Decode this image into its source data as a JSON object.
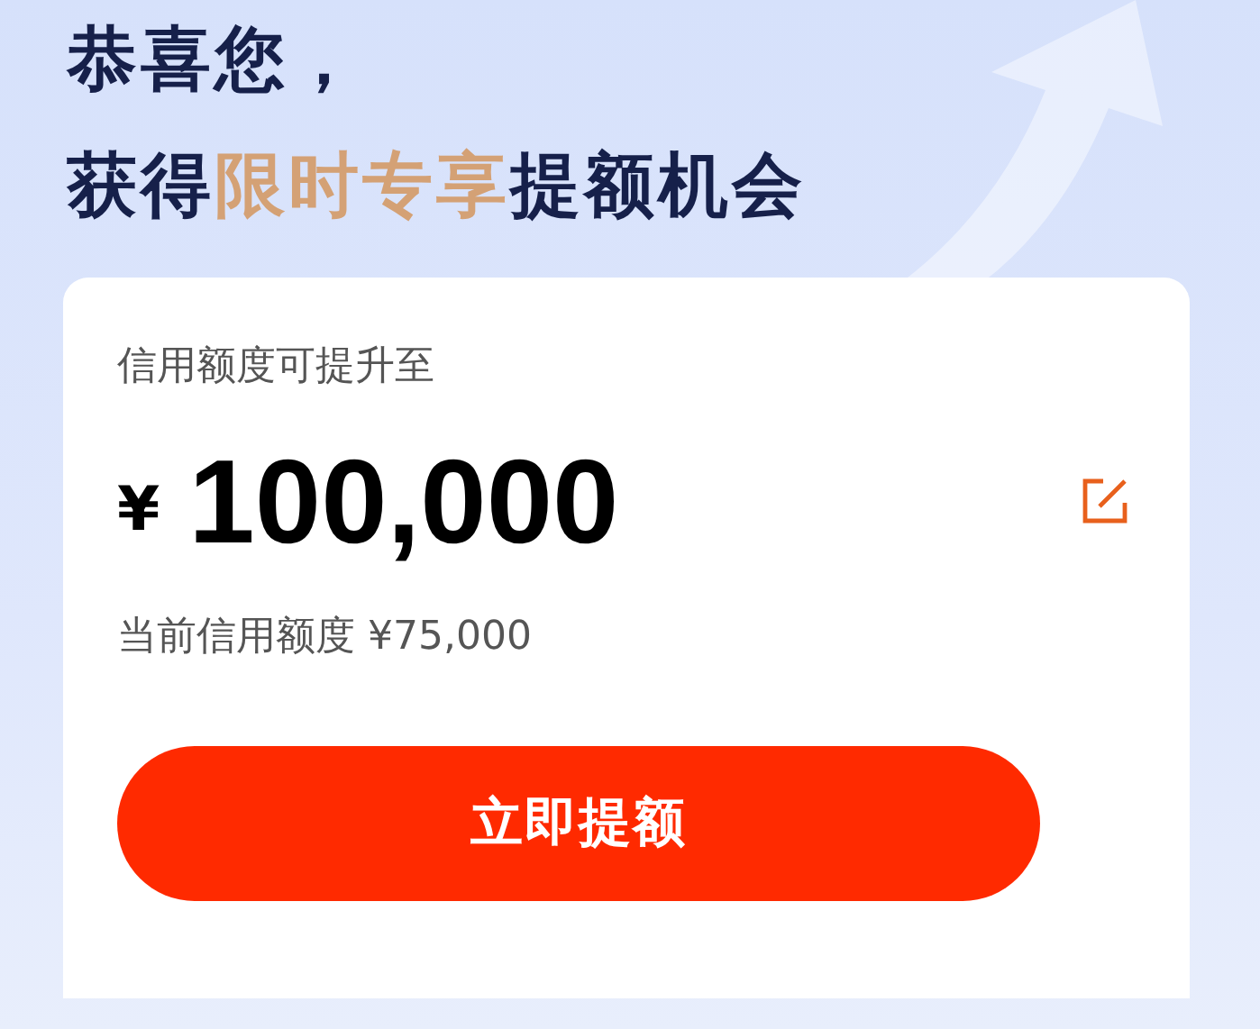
{
  "headline": {
    "line_1": "恭喜您，",
    "line_2": [
      {
        "text": "获得",
        "highlight": false
      },
      {
        "text": "限时专享",
        "highlight": true
      },
      {
        "text": "提额机会",
        "highlight": false
      }
    ]
  },
  "card": {
    "label": "信用额度可提升至",
    "currency": "¥",
    "amount": "100,000",
    "current": "当前信用额度 ¥75,000",
    "button": "立即提额"
  }
}
